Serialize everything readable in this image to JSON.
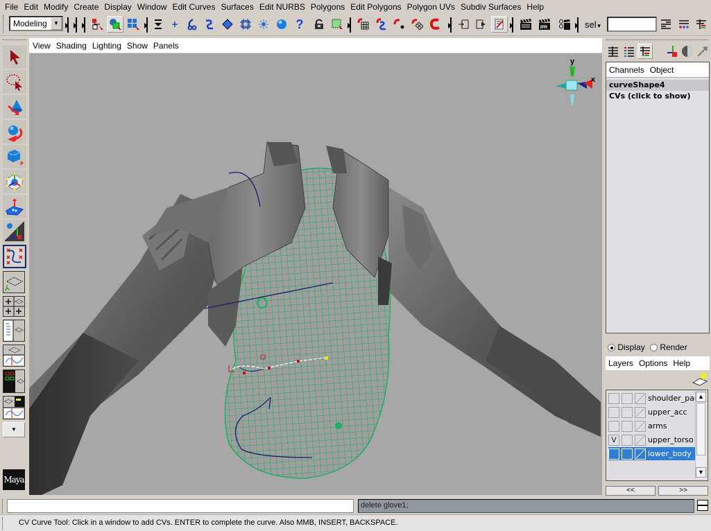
{
  "menubar": {
    "items": [
      "File",
      "Edit",
      "Modify",
      "Create",
      "Display",
      "Window",
      "Edit Curves",
      "Surfaces",
      "Edit NURBS",
      "Polygons",
      "Edit Polygons",
      "Polygon UVs",
      "Subdiv Surfaces",
      "Help"
    ]
  },
  "toolbar": {
    "mode_selector": "Modeling",
    "selection_mode_label": "sel",
    "selection_input_value": "",
    "icons": {
      "select_by_hierarchy": "hierarchy-select-icon",
      "select_by_object": "object-select-icon",
      "select_by_component": "component-select-icon",
      "snap_grid": "snap-grid-icon",
      "snap_curve": "snap-curve-icon",
      "snap_point": "snap-point-icon",
      "snap_view_plane": "snap-view-plane-icon",
      "make_live": "make-live-icon",
      "history": "history-icon",
      "render": "render-icon",
      "ipr_render": "ipr-render-icon",
      "render_globals": "render-globals-icon"
    }
  },
  "toolbox": {
    "tools": [
      "select-tool",
      "lasso-tool",
      "move-tool",
      "rotate-tool",
      "scale-tool",
      "universal-manipulator",
      "soft-mod-tool",
      "show-manipulator",
      "cv-curve-tool"
    ],
    "logo": "Maya"
  },
  "viewport": {
    "menu": [
      "View",
      "Shading",
      "Lighting",
      "Show",
      "Panels"
    ],
    "axis_labels": {
      "y": "y",
      "x": "x"
    },
    "wireframe_color": "#1fae62",
    "background_color": "#a7a7a7"
  },
  "channel_box": {
    "menu": [
      "Channels",
      "Object"
    ],
    "object_name": "curveShape4",
    "cvs_label": "CVs (click to show)"
  },
  "layer_editor": {
    "mode_options": [
      {
        "label": "Display",
        "selected": true
      },
      {
        "label": "Render",
        "selected": false
      }
    ],
    "menu": [
      "Layers",
      "Options",
      "Help"
    ],
    "layers": [
      {
        "name": "shoulder_pads",
        "visible": "",
        "selected": false
      },
      {
        "name": "upper_acc",
        "visible": "",
        "selected": false
      },
      {
        "name": "arms",
        "visible": "",
        "selected": false
      },
      {
        "name": "upper_torso",
        "visible": "V",
        "selected": false
      },
      {
        "name": "lower_body",
        "visible": "",
        "selected": true
      }
    ],
    "prev_page": "<<",
    "next_page": ">>"
  },
  "command_line": {
    "input_value": "",
    "output_text": "delete glove1;"
  },
  "help_line": {
    "text": "CV Curve Tool: Click in a window to add CVs. ENTER to complete the curve. Also MMB, INSERT, BACKSPACE."
  }
}
